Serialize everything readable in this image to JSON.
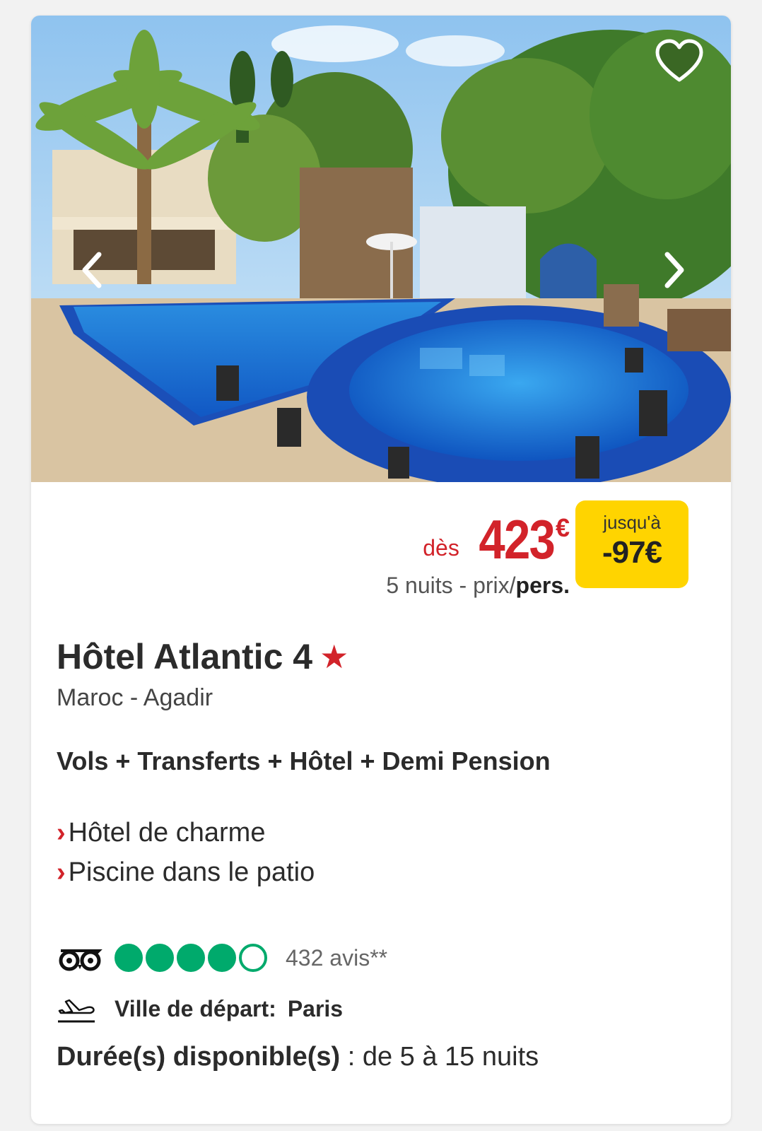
{
  "colors": {
    "accent_red": "#d2232a",
    "discount_yellow": "#ffd400",
    "tripadvisor_green": "#00aa6c"
  },
  "gallery": {
    "prev_icon": "chevron-left-icon",
    "next_icon": "chevron-right-icon",
    "favorite_icon": "heart-outline-icon"
  },
  "price": {
    "prefix": "dès",
    "amount": "423",
    "currency": "€",
    "nights": "5 nuits - prix/",
    "per": "pers."
  },
  "discount": {
    "label": "jusqu'à",
    "value": "-97€"
  },
  "hotel": {
    "name": "Hôtel Atlantic 4",
    "star": "★",
    "location": "Maroc - Agadir",
    "formula": "Vols + Transferts + Hôtel + Demi Pension",
    "features": [
      "Hôtel de charme",
      "Piscine dans le patio"
    ]
  },
  "rating": {
    "provider_icon": "tripadvisor-owl-icon",
    "bubbles_filled": 4,
    "bubbles_total": 5,
    "reviews": "432 avis**"
  },
  "departure": {
    "icon": "plane-takeoff-icon",
    "label": "Ville de départ:",
    "city": "Paris"
  },
  "duration": {
    "label": "Durée(s) disponible(s)",
    "value": " : de 5 à 15 nuits"
  }
}
